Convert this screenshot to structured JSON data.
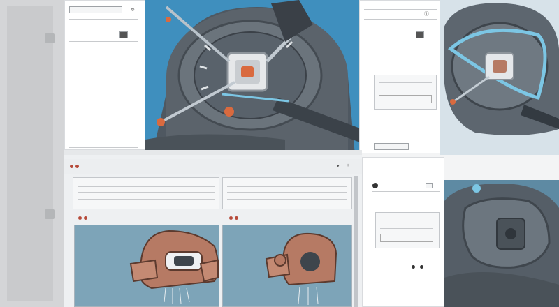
{
  "top_left_panel": {
    "toolbar_labels": [
      "",
      "",
      ""
    ],
    "caption": ""
  },
  "bottom_panel": {
    "header_labels": [
      "",
      "",
      ""
    ],
    "left_view": {
      "tab_label": "",
      "row_label": ""
    },
    "right_view": {
      "tab_label": "",
      "row_label": ""
    }
  },
  "right_panel": {
    "upper_label": "",
    "lower_label": ""
  },
  "colors": {
    "sky_blue": "#3f8fbe",
    "machine_gray": "#5b636b",
    "copper": "#b67a64",
    "accent_orange": "#d96a3f",
    "cyan_outline": "#7cc6e4",
    "viewport_bg": "#7da4b8"
  },
  "icons": [
    "reset-icon",
    "chevron-icon",
    "plus-icon",
    "info-icon"
  ]
}
